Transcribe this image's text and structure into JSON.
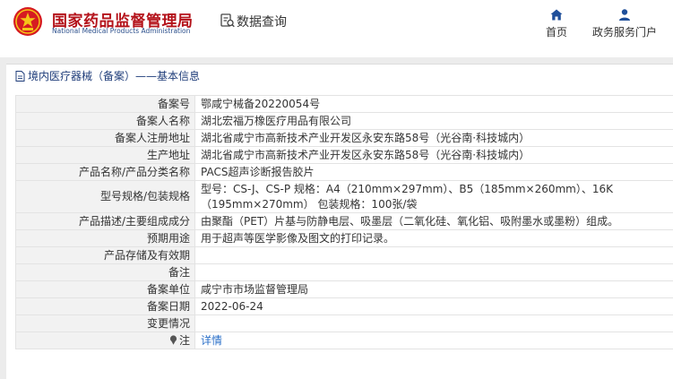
{
  "header": {
    "brand_cn": "国家药品监督管理局",
    "brand_en": "National Medical Products Administration",
    "query_label": "数据查询",
    "nav": [
      {
        "label": "首页",
        "icon": "home-icon"
      },
      {
        "label": "政务服务门户",
        "icon": "user-icon"
      }
    ]
  },
  "breadcrumb": "境内医疗器械（备案）——基本信息",
  "records": [
    {
      "key": "备案号",
      "value": "鄂咸宁械备20220054号"
    },
    {
      "key": "备案人名称",
      "value": "湖北宏福万橡医疗用品有限公司"
    },
    {
      "key": "备案人注册地址",
      "value": "湖北省咸宁市高新技术产业开发区永安东路58号（光谷南·科技城内）"
    },
    {
      "key": "生产地址",
      "value": "湖北省咸宁市高新技术产业开发区永安东路58号（光谷南·科技城内）"
    },
    {
      "key": "产品名称/产品分类名称",
      "value": "PACS超声诊断报告胶片"
    },
    {
      "key": "型号规格/包装规格",
      "value": "型号：CS-J、CS-P 规格：A4（210mm×297mm）、B5（185mm×260mm）、16K（195mm×270mm） 包装规格：100张/袋"
    },
    {
      "key": "产品描述/主要组成成分",
      "value": "由聚酯（PET）片基与防静电层、吸墨层（二氧化硅、氧化铝、吸附墨水或墨粉）组成。"
    },
    {
      "key": "预期用途",
      "value": "用于超声等医学影像及图文的打印记录。"
    },
    {
      "key": "产品存储及有效期",
      "value": ""
    },
    {
      "key": "备注",
      "value": ""
    },
    {
      "key": "备案单位",
      "value": "咸宁市市场监督管理局"
    },
    {
      "key": "备案日期",
      "value": "2022-06-24"
    },
    {
      "key": "变更情况",
      "value": ""
    },
    {
      "key": "注",
      "value": "详情"
    }
  ],
  "colors": {
    "brand_red": "#b4121a",
    "nav_blue": "#1f3d7a",
    "link_blue": "#2a6fc8"
  }
}
